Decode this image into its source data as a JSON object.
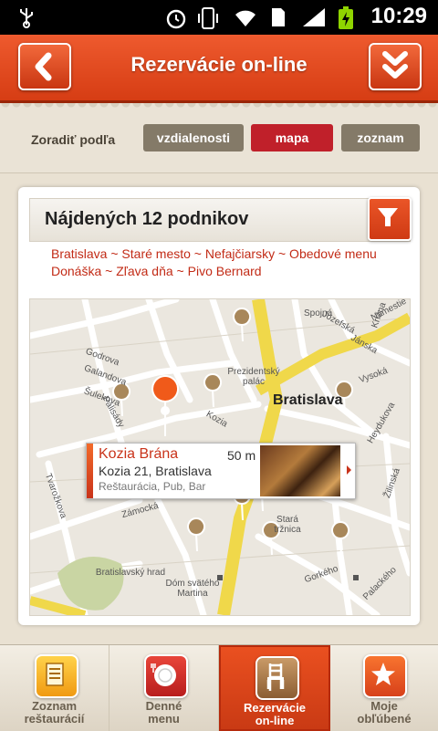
{
  "status_bar": {
    "time": "10:29"
  },
  "header": {
    "title": "Rezervácie on-line"
  },
  "sort": {
    "label": "Zoradiť podľa",
    "options": [
      "vzdialenosti",
      "mapa",
      "zoznam"
    ],
    "selected": "mapa"
  },
  "results": {
    "title": "Nájdených 12 podnikov",
    "tags_line1": "Bratislava ~ Staré mesto ~ Nefajčiarsky ~ Obedové menu",
    "tags_line2": "Donáška ~ Zľava dňa ~ Pivo Bernard"
  },
  "map": {
    "city_label": "Bratislava",
    "street_labels": [
      "Spojná",
      "Námestie",
      "Jozefská",
      "Jánska",
      "Vysoká",
      "Heydukova",
      "Krížna",
      "Godrova",
      "Galandova",
      "Palisády",
      "Šulekova",
      "Prezidentský palác",
      "Kozia",
      "Zámocká",
      "Bratislavský hrad",
      "Dóm svätého Martina",
      "Stará tržnica",
      "Gorkého",
      "Palackého",
      "Žilinská",
      "Tvarožkova"
    ],
    "popup": {
      "name": "Kozia Brána",
      "distance": "50 m",
      "address": "Kozia 21, Bratislava",
      "type": "Reštaurácia, Pub, Bar"
    }
  },
  "bottom_nav": [
    {
      "label_line1": "Zoznam",
      "label_line2": "reštaurácií",
      "icon": "list-icon",
      "active": false
    },
    {
      "label_line1": "Denné",
      "label_line2": "menu",
      "icon": "plate-icon",
      "active": false
    },
    {
      "label_line1": "Rezervácie",
      "label_line2": "on-line",
      "icon": "chair-icon",
      "active": true
    },
    {
      "label_line1": "Moje",
      "label_line2": "obľúbené",
      "icon": "star-icon",
      "active": false
    }
  ],
  "colors": {
    "accent": "#d63d14",
    "selected": "#c0202a",
    "tag": "#c22b16"
  }
}
